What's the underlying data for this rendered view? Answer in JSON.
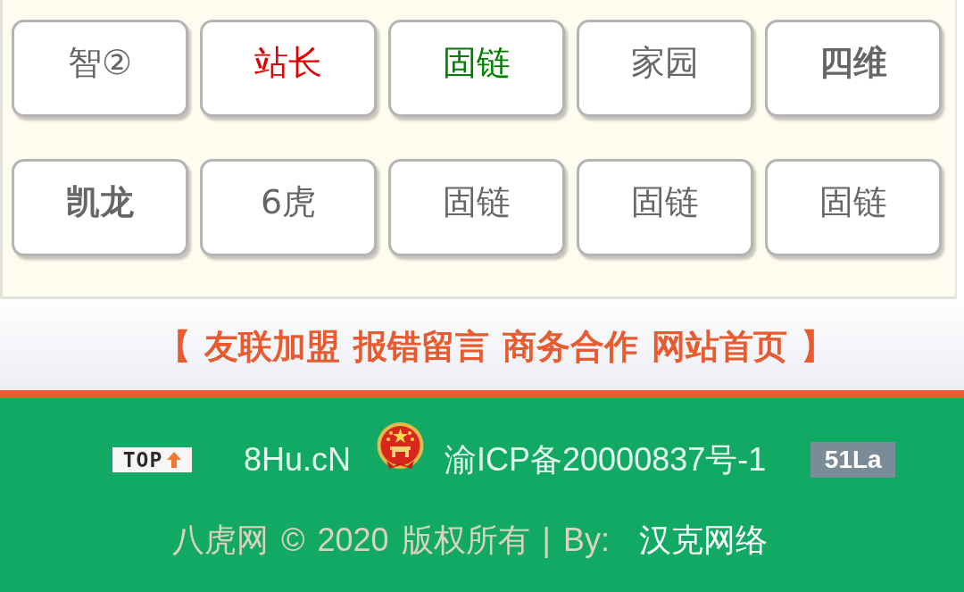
{
  "link_grid": {
    "links": [
      {
        "label": "智②",
        "color": "#666666",
        "bold": false
      },
      {
        "label": "站长",
        "color": "#dd0000",
        "bold": false
      },
      {
        "label": "固链",
        "color": "#008000",
        "bold": false
      },
      {
        "label": "家园",
        "color": "#666666",
        "bold": false
      },
      {
        "label": "四维",
        "color": "#666666",
        "bold": true
      },
      {
        "label": "凯龙",
        "color": "#666666",
        "bold": true
      },
      {
        "label": "6虎",
        "color": "#666666",
        "bold": false
      },
      {
        "label": "固链",
        "color": "#666666",
        "bold": false
      },
      {
        "label": "固链",
        "color": "#666666",
        "bold": false
      },
      {
        "label": "固链",
        "color": "#666666",
        "bold": false
      }
    ]
  },
  "nav_bar": {
    "open_bracket": "【",
    "links": [
      "友联加盟",
      "报错留言",
      "商务合作",
      "网站首页"
    ],
    "close_bracket": "】"
  },
  "footer": {
    "top_button": "TOP",
    "site_name": "8Hu.cN",
    "icp_number": "渝ICP备20000837号-1",
    "stats_badge": "51La",
    "copyright": "八虎网 © 2020 版权所有 | By:",
    "author": "汉克网络"
  }
}
